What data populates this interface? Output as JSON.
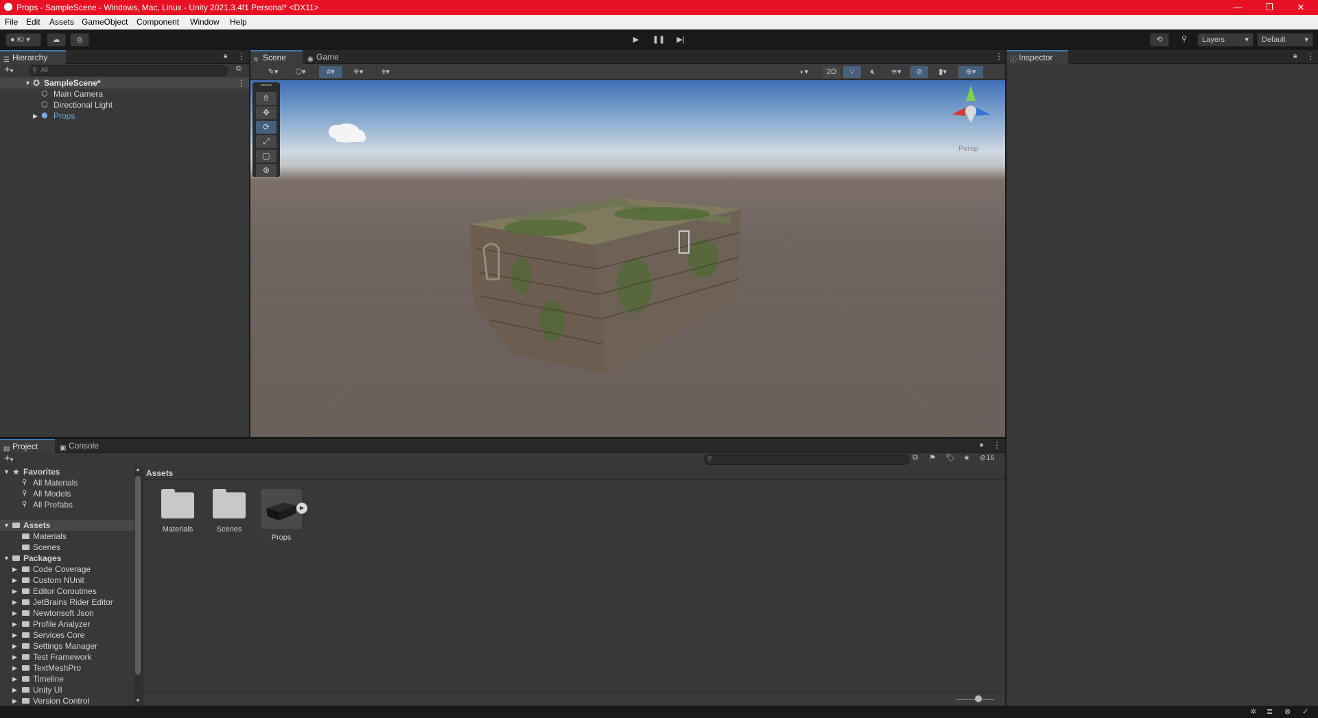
{
  "window": {
    "title": "Props - SampleScene - Windows, Mac, Linux - Unity 2021.3.4f1 Personal* <DX11>",
    "minimize": "—",
    "maximize": "❐",
    "close": "✕"
  },
  "menu": [
    "File",
    "Edit",
    "Assets",
    "GameObject",
    "Component",
    "Window",
    "Help"
  ],
  "toolbar": {
    "account": "KI",
    "layers": "Layers",
    "layout": "Default"
  },
  "hierarchy": {
    "tab": "Hierarchy",
    "search_placeholder": "All",
    "scene": "SampleScene*",
    "items": [
      "Main Camera",
      "Directional Light",
      "Props"
    ]
  },
  "scene": {
    "tabs": [
      "Scene",
      "Game"
    ],
    "mode_2d": "2D",
    "gizmo_label": "Persp"
  },
  "inspector": {
    "tab": "Inspector"
  },
  "project": {
    "tabs": [
      "Project",
      "Console"
    ],
    "favorites_label": "Favorites",
    "favorites": [
      "All Materials",
      "All Models",
      "All Prefabs"
    ],
    "assets_label": "Assets",
    "asset_folders": [
      "Materials",
      "Scenes"
    ],
    "packages_label": "Packages",
    "packages": [
      "Code Coverage",
      "Custom NUnit",
      "Editor Coroutines",
      "JetBrains Rider Editor",
      "Newtonsoft Json",
      "Profile Analyzer",
      "Services Core",
      "Settings Manager",
      "Test Framework",
      "TextMeshPro",
      "Timeline",
      "Unity UI",
      "Version Control"
    ],
    "breadcrumb": "Assets",
    "tiles": [
      "Materials",
      "Scenes",
      "Props"
    ],
    "hidden_count": "16"
  },
  "colors": {
    "titlebar": "#e81123",
    "accent": "#3a79bb",
    "prefab_blue": "#7aa7e8"
  }
}
